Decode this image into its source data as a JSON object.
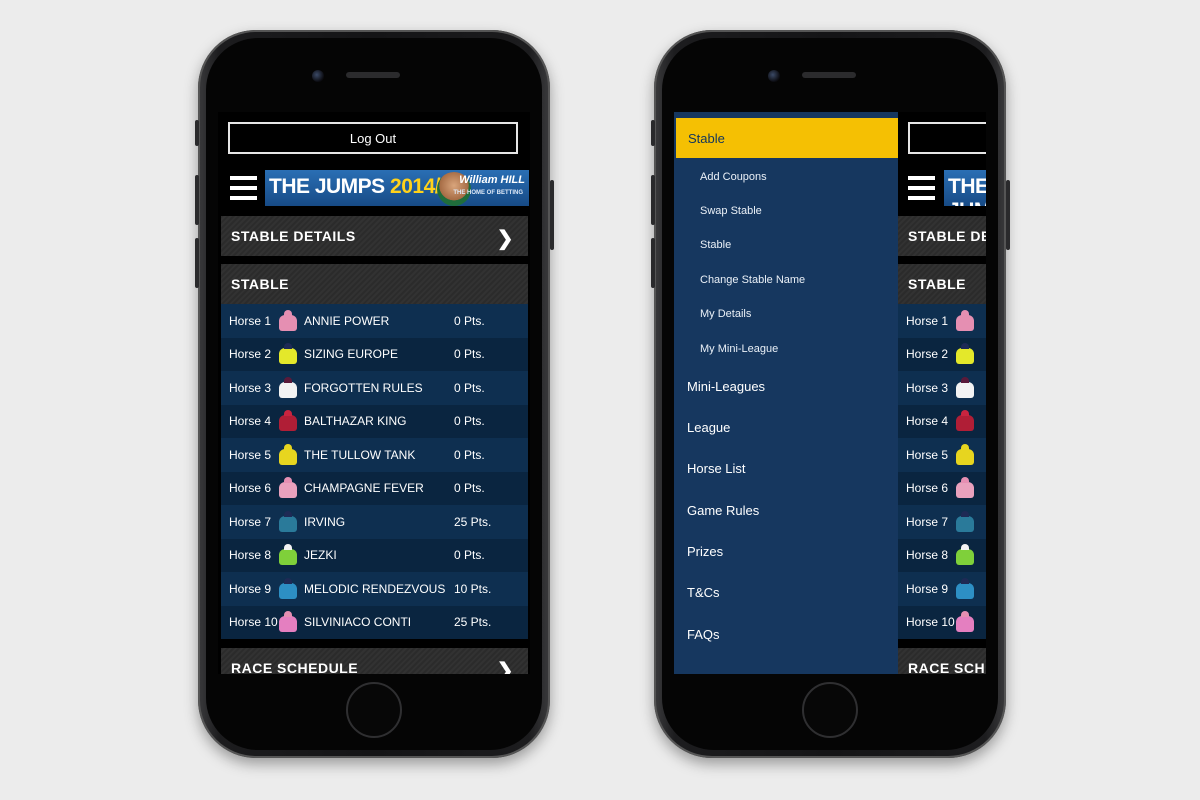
{
  "app": {
    "logout_label": "Log Out",
    "banner": {
      "title": "THE JUMPS",
      "year": "2014/15",
      "sponsor": "William HILL",
      "tagline": "THE HOME OF BETTING"
    },
    "sections": {
      "details": "STABLE DETAILS",
      "stable": "STABLE",
      "schedule": "RACE SCHEDULE"
    },
    "horses": [
      {
        "num": "Horse 1",
        "name": "ANNIE POWER",
        "pts": "0 Pts.",
        "cap": "#e58fb2",
        "body": "#e58fb2"
      },
      {
        "num": "Horse 2",
        "name": "SIZING EUROPE",
        "pts": "0 Pts.",
        "cap": "#1e2a55",
        "body": "#e4e82a"
      },
      {
        "num": "Horse 3",
        "name": "FORGOTTEN RULES",
        "pts": "0 Pts.",
        "cap": "#5a1a3a",
        "body": "#f3f3f3"
      },
      {
        "num": "Horse 4",
        "name": "BALTHAZAR KING",
        "pts": "0 Pts.",
        "cap": "#c8243f",
        "body": "#b01e36"
      },
      {
        "num": "Horse 5",
        "name": "THE TULLOW TANK",
        "pts": "0 Pts.",
        "cap": "#e7d51f",
        "body": "#e7d51f"
      },
      {
        "num": "Horse 6",
        "name": "CHAMPAGNE FEVER",
        "pts": "0 Pts.",
        "cap": "#e58fb2",
        "body": "#e9a1bd"
      },
      {
        "num": "Horse 7",
        "name": "IRVING",
        "pts": "25 Pts.",
        "cap": "#1e2a55",
        "body": "#2a7a9a"
      },
      {
        "num": "Horse 8",
        "name": "JEZKI",
        "pts": "0 Pts.",
        "cap": "#f3f3f3",
        "body": "#7fd03a"
      },
      {
        "num": "Horse 9",
        "name": "MELODIC RENDEZVOUS",
        "pts": "10 Pts.",
        "cap": "#1e2a55",
        "body": "#2d8fc4"
      },
      {
        "num": "Horse 10",
        "name": "SILVINIACO CONTI",
        "pts": "25 Pts.",
        "cap": "#e58fb2",
        "body": "#e47fc0"
      }
    ]
  },
  "menu": {
    "active": "Stable",
    "sub_items": [
      "Add Coupons",
      "Swap Stable",
      "Stable",
      "Change Stable Name",
      "My Details",
      "My Mini-League"
    ],
    "main_items": [
      "Mini-Leagues",
      "League",
      "Horse List",
      "Game Rules",
      "Prizes",
      "T&Cs",
      "FAQs"
    ]
  },
  "colors": {
    "menu_bg": "#16375f",
    "active_bg": "#f5c003",
    "row_odd": "#0e2f50",
    "row_even": "#0a2540"
  }
}
